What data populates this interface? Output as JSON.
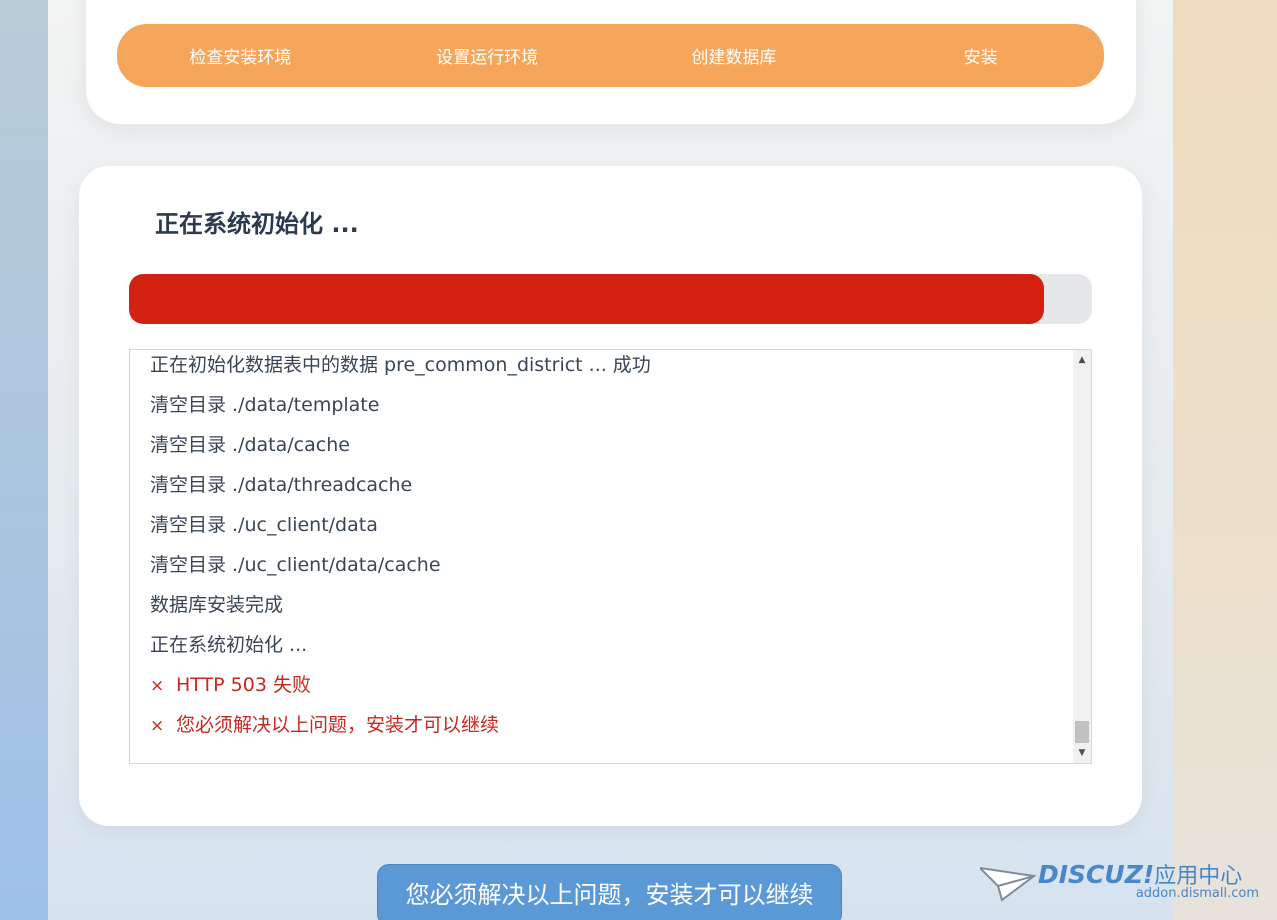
{
  "steps": [
    {
      "label": "检查安装环境"
    },
    {
      "label": "设置运行环境"
    },
    {
      "label": "创建数据库"
    },
    {
      "label": "安装"
    }
  ],
  "main": {
    "title": "正在系统初始化 ...",
    "progress_fraction": 0.95
  },
  "log": {
    "lines": [
      {
        "text": "正在初始化数据表中的数据 pre_common_district ... 成功",
        "error": false
      },
      {
        "text": "清空目录 ./data/template",
        "error": false
      },
      {
        "text": "清空目录 ./data/cache",
        "error": false
      },
      {
        "text": "清空目录 ./data/threadcache",
        "error": false
      },
      {
        "text": "清空目录 ./uc_client/data",
        "error": false
      },
      {
        "text": "清空目录 ./uc_client/data/cache",
        "error": false
      },
      {
        "text": "数据库安装完成",
        "error": false
      },
      {
        "text": "正在系统初始化 ...",
        "error": false
      },
      {
        "text": "HTTP 503 失败",
        "error": true
      },
      {
        "text": "您必须解决以上问题，安装才可以继续",
        "error": true
      }
    ],
    "error_mark": "×"
  },
  "continue_button": {
    "label": "您必须解决以上问题，安装才可以继续"
  },
  "watermark": {
    "brand": "DISCUZ!",
    "brand_cn": "应用中心",
    "url": "addon.dismall.com"
  },
  "colors": {
    "step_bar": "#f6a65a",
    "progress_fill": "#d22110",
    "error_text": "#c8281e",
    "button": "#5b98d6"
  },
  "icons": {
    "scroll_up": "▲",
    "scroll_down": "▼"
  }
}
